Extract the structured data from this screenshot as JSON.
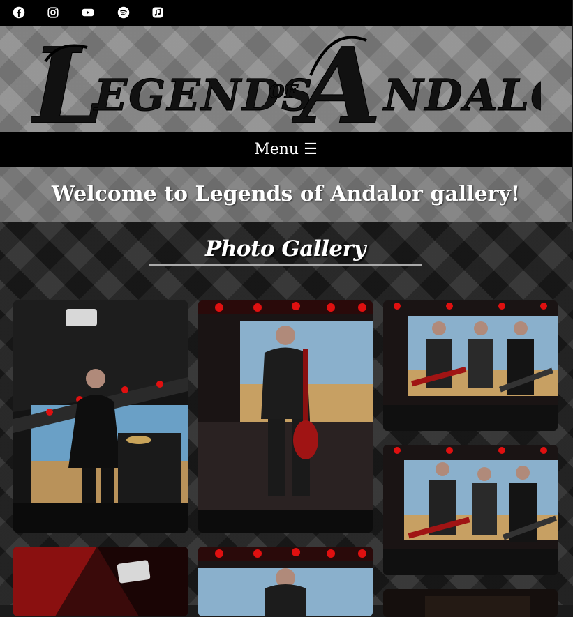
{
  "social": {
    "icons": [
      "facebook-icon",
      "instagram-icon",
      "youtube-icon",
      "spotify-icon",
      "apple-music-icon"
    ]
  },
  "banner": {
    "logo_text_parts": [
      "L",
      "EGENDS",
      "OF",
      "A",
      "NDALOR"
    ]
  },
  "menu": {
    "label": "Menu ☰"
  },
  "welcome": {
    "text": "Welcome to Legends of Andalor gallery!"
  },
  "gallery": {
    "title": "Photo Gallery",
    "photos": [
      "photo-singer-on-stage",
      "photo-guitarist-red-guitar",
      "photo-band-trio-1",
      "photo-band-trio-2",
      "photo-stage-speaker",
      "photo-guitarist-stage",
      "photo-dark"
    ]
  },
  "colors": {
    "header_bg": "#000000",
    "banner_bg": "#8a8a8a",
    "section_bg": "#262626",
    "stage_red": "#e01010"
  }
}
